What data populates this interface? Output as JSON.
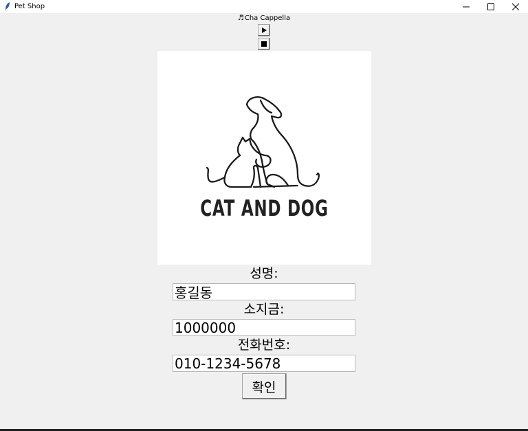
{
  "window": {
    "title": "Pet Shop",
    "minimize_icon": "minimize-icon",
    "maximize_icon": "maximize-icon",
    "close_icon": "close-icon"
  },
  "player": {
    "note_icon": "♬",
    "track_name": "Cha Cappella",
    "play_icon": "play-icon",
    "stop_icon": "stop-icon"
  },
  "logo": {
    "text": "CAT AND DOG"
  },
  "form": {
    "name_label": "성명:",
    "name_value": "홍길동",
    "money_label": "소지금:",
    "money_value": "1000000",
    "phone_label": "전화번호:",
    "phone_value": "010-1234-5678",
    "confirm_label": "확인"
  }
}
